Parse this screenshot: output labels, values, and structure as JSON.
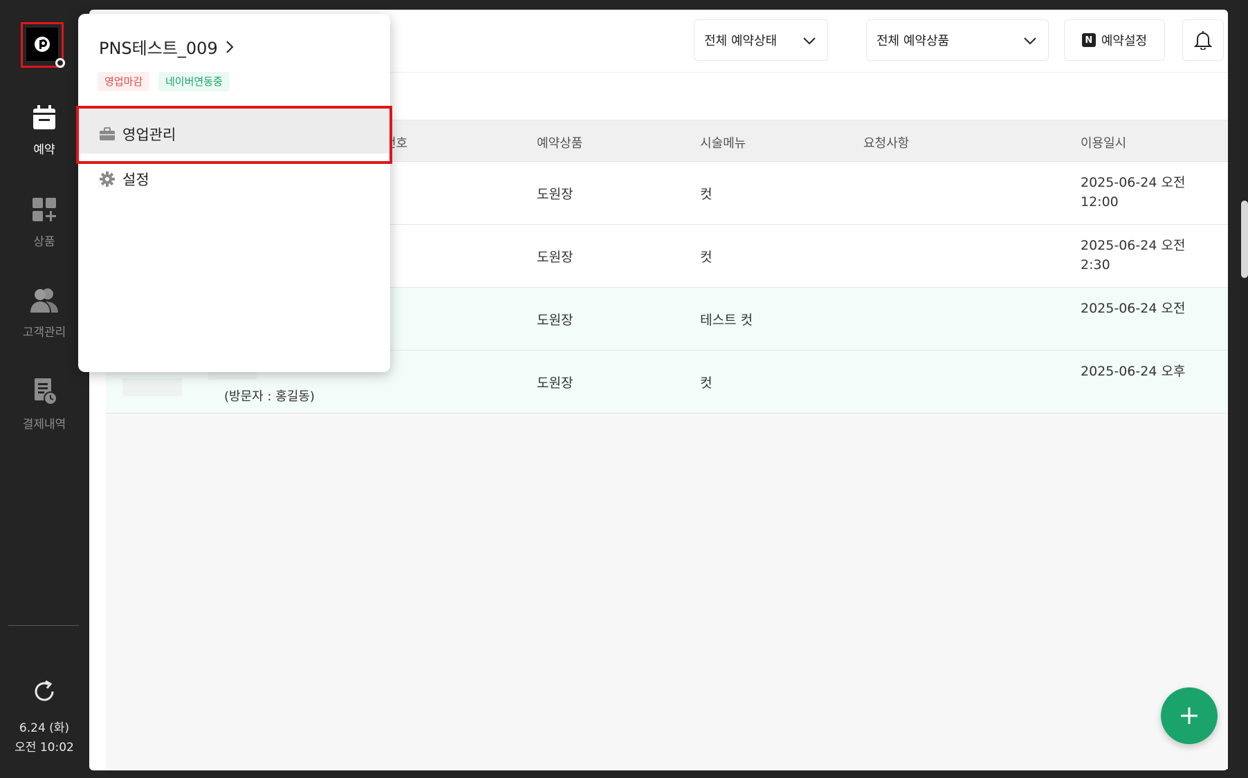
{
  "sidebar": {
    "items": [
      {
        "label": "예약",
        "icon": "calendar-icon",
        "active": true
      },
      {
        "label": "상품",
        "icon": "grid-plus-icon",
        "active": false
      },
      {
        "label": "고객관리",
        "icon": "users-icon",
        "active": false
      },
      {
        "label": "결제내역",
        "icon": "receipt-clock-icon",
        "active": false
      }
    ],
    "date_line1": "6.24 (화)",
    "date_line2": "오전 10:02"
  },
  "header": {
    "status_filter": "전체 예약상태",
    "product_filter": "전체 예약상품",
    "settings_label": "예약설정",
    "settings_badge": "N"
  },
  "table": {
    "columns": [
      "번호",
      "예약상품",
      "시술메뉴",
      "요청사항",
      "이용일시"
    ],
    "rows": [
      {
        "product": "도원장",
        "menu": "컷",
        "request": "",
        "date1": "2025-06-24 오전",
        "date2": "12:00"
      },
      {
        "product": "도원장",
        "menu": "컷",
        "request": "",
        "date1": "2025-06-24 오전",
        "date2": "2:30"
      },
      {
        "product": "도원장",
        "menu": "테스트 컷",
        "request": "",
        "date1": "2025-06-24 오전",
        "date2": ""
      },
      {
        "product": "도원장",
        "menu": "컷",
        "request": "",
        "date1": "2025-06-24 오후",
        "date2": "",
        "visitor": "(방문자 : 홍길동)"
      }
    ]
  },
  "popup": {
    "shop_name": "PNS테스트_009",
    "tag_closed": "영업마감",
    "tag_naver": "네이버연동중",
    "menu": [
      {
        "label": "영업관리",
        "icon": "briefcase-icon"
      },
      {
        "label": "설정",
        "icon": "gear-icon"
      }
    ]
  },
  "colors": {
    "accent": "#1aa46c",
    "highlight": "#e0151b",
    "sidebar": "#242424"
  }
}
